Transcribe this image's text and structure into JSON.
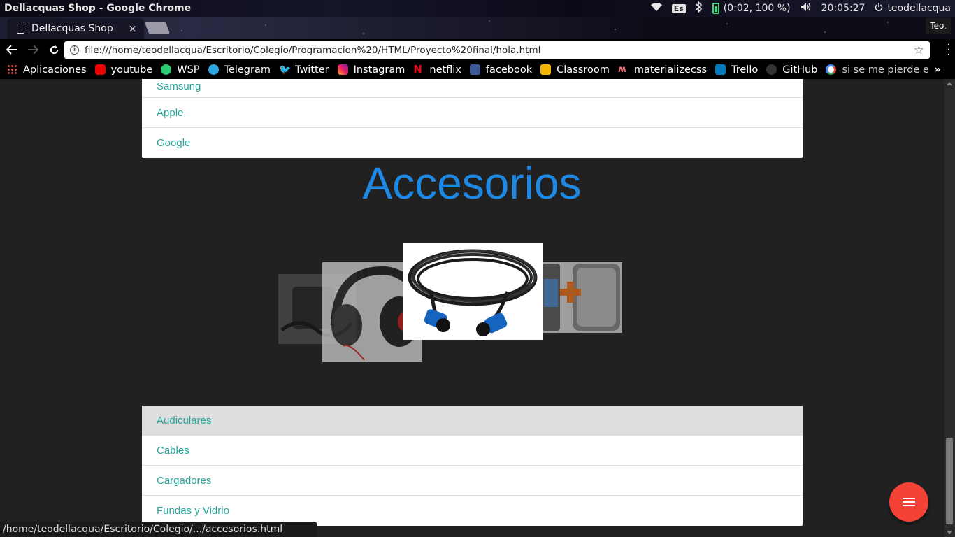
{
  "os_panel": {
    "window_title": "Dellacquas Shop - Google Chrome",
    "keyboard_layout": "Es",
    "battery_text": "(0:02, 100 %)",
    "clock": "20:05:27",
    "user": "teodellacqua"
  },
  "browser": {
    "tab_title": "Dellacquas Shop",
    "tab_close": "×",
    "profile_label": "Teo.",
    "url": "file:///home/teodellacqua/Escritorio/Colegio/Programacion%20/HTML/Proyecto%20final/hola.html",
    "status_url": "/home/teodellacqua/Escritorio/Colegio/.../accesorios.html"
  },
  "bookmarks": [
    {
      "label": "Aplicaciones",
      "icon": "apps-icon"
    },
    {
      "label": "youtube",
      "icon": "youtube-icon"
    },
    {
      "label": "WSP",
      "icon": "whatsapp-icon"
    },
    {
      "label": "Telegram",
      "icon": "telegram-icon"
    },
    {
      "label": "Twitter",
      "icon": "twitter-icon"
    },
    {
      "label": "Instagram",
      "icon": "instagram-icon"
    },
    {
      "label": "netflix",
      "icon": "netflix-icon"
    },
    {
      "label": "facebook",
      "icon": "facebook-icon"
    },
    {
      "label": "Classroom",
      "icon": "classroom-icon"
    },
    {
      "label": "materializecss",
      "icon": "materialize-icon"
    },
    {
      "label": "Trello",
      "icon": "trello-icon"
    },
    {
      "label": "GitHub",
      "icon": "github-icon"
    },
    {
      "label": "si se me pierde e",
      "icon": "google-icon"
    }
  ],
  "bookmarks_overflow": "»",
  "page": {
    "brands": [
      "Samsung",
      "Apple",
      "Google"
    ],
    "section_title": "Accesorios",
    "accessories": [
      "Audiculares",
      "Cables",
      "Cargadores",
      "Fundas y Vidrio"
    ],
    "hovered_accessory": "Audiculares"
  },
  "colors": {
    "page_bg": "#212121",
    "link": "#26a69a",
    "title": "#1e88e5",
    "fab": "#f44336"
  }
}
